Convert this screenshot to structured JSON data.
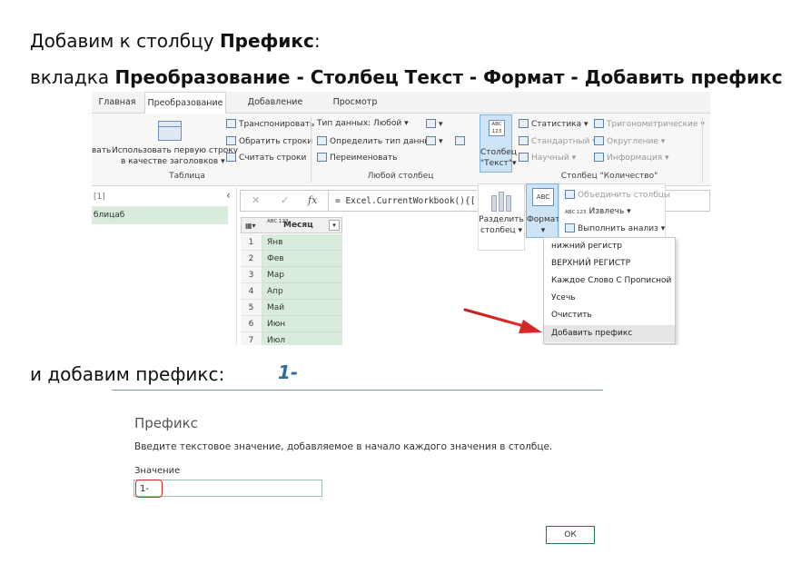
{
  "instructions": {
    "line1_pre": "Добавим к столбцу ",
    "line1_bold": "Префикс",
    "line1_post": ":",
    "line2_pre": "вкладка ",
    "line2_bold": "Преобразование - Столбец Текст - Формат - Добавить префикс",
    "line3_pre": "и добавим префикс:",
    "line3_value": "1-",
    "value_color": "#2e6da4"
  },
  "ribbon": {
    "tabs": [
      "Главная",
      "Преобразование",
      "Добавление столбца",
      "Просмотр"
    ],
    "active_tab": "Преобразование",
    "table_group": {
      "cut_label": "вать",
      "use_first_row_line1": "Использовать первую строку",
      "use_first_row_line2": "в качестве заголовков",
      "transpose": "Транспонировать",
      "reverse_rows": "Обратить строки",
      "count_rows": "Считать строки",
      "group_label": "Таблица"
    },
    "any_column_group": {
      "data_type": "Тип данных: Любой",
      "detect_type": "Определить тип данных",
      "rename": "Переименовать",
      "group_label": "Любой столбец"
    },
    "text_column": {
      "icon_text": "ABC 123",
      "label_line1": "Столбец",
      "label_line2": "\"Текст\""
    },
    "number_column_group": {
      "statistics": "Статистика",
      "standard": "Стандартный",
      "scientific": "Научный",
      "trig": "Тригонометрические",
      "rounding": "Округление",
      "info": "Информация",
      "group_label": "Столбец \"Количество\""
    }
  },
  "query": {
    "left_label_top": "[1]",
    "left_item": "блицаб",
    "formula": "= Excel.CurrentWorkbook(){[",
    "cancel_icon": "✕",
    "check_icon": "✓",
    "fx": "fx"
  },
  "grid": {
    "column_icon": "ABC 123",
    "column_header": "Месяц",
    "rows": [
      {
        "n": "1",
        "v": "Янв"
      },
      {
        "n": "2",
        "v": "Фев"
      },
      {
        "n": "3",
        "v": "Мар"
      },
      {
        "n": "4",
        "v": "Апр"
      },
      {
        "n": "5",
        "v": "Май"
      },
      {
        "n": "6",
        "v": "Июн"
      },
      {
        "n": "7",
        "v": "Июл"
      }
    ]
  },
  "text_tools": {
    "split_line1": "Разделить",
    "split_line2": "столбец",
    "format_icon_text": "ABC",
    "format_label": "Формат",
    "merge": "Объединить столбцы",
    "extract_icon_text": "ABC 123",
    "extract": "Извлечь",
    "analyze": "Выполнить анализ"
  },
  "format_menu": {
    "items": [
      "нижний регистр",
      "ВЕРХНИЙ РЕГИСТР",
      "Каждое Слово С Прописной",
      "Усечь",
      "Очистить",
      "Добавить префикс"
    ],
    "highlighted": "Добавить префикс"
  },
  "dialog": {
    "title": "Префикс",
    "description": "Введите текстовое значение, добавляемое в начало каждого значения в столбце.",
    "field_label": "Значение",
    "field_value": "1-",
    "ok_label": "ОК"
  }
}
